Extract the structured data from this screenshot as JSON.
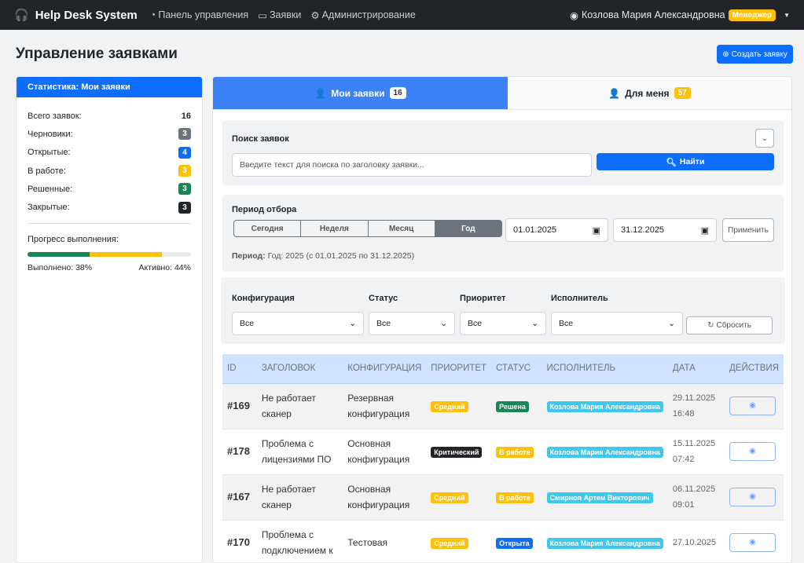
{
  "nav": {
    "brand": "Help Desk System",
    "links": [
      "Панель управления",
      "Заявки",
      "Администрирование"
    ],
    "user": "Козлова Мария Александровна",
    "role": "Менеджер"
  },
  "page": {
    "title": "Управление заявками",
    "create": "Создать заявку"
  },
  "stats": {
    "title": "Статистика: Мои заявки",
    "total_label": "Всего заявок:",
    "total": "16",
    "items": [
      {
        "label": "Черновики:",
        "value": "3",
        "color": "#6c757d"
      },
      {
        "label": "Открытые:",
        "value": "4",
        "color": "#0d6efd"
      },
      {
        "label": "В работе:",
        "value": "3",
        "color": "#ffc107"
      },
      {
        "label": "Решенные:",
        "value": "3",
        "color": "#198754"
      },
      {
        "label": "Закрытые:",
        "value": "3",
        "color": "#212529"
      }
    ],
    "progress_label": "Прогресс выполнения:",
    "done_pct": 38,
    "active_pct": 44,
    "done_text": "Выполнено: 38%",
    "active_text": "Активно: 44%"
  },
  "tabs": [
    {
      "label": "Мои заявки",
      "count": "16"
    },
    {
      "label": "Для меня",
      "count": "57"
    }
  ],
  "search": {
    "label": "Поиск заявок",
    "placeholder": "Введите текст для поиска по заголовку заявки...",
    "button": "Найти"
  },
  "period": {
    "label": "Период отбора",
    "options": [
      "Сегодня",
      "Неделя",
      "Месяц",
      "Год"
    ],
    "from": "01.01.2025",
    "to": "31.12.2025",
    "apply": "Применить",
    "summary_label": "Период:",
    "summary": "Год: 2025 (с 01.01.2025 по 31.12.2025)"
  },
  "filters": {
    "fields": [
      {
        "label": "Конфигурация",
        "value": "Все"
      },
      {
        "label": "Статус",
        "value": "Все"
      },
      {
        "label": "Приоритет",
        "value": "Все"
      },
      {
        "label": "Исполнитель",
        "value": "Все"
      }
    ],
    "reset": "Сбросить"
  },
  "table": {
    "headers": [
      "ID",
      "ЗАГОЛОВОК",
      "КОНФИГУРАЦИЯ",
      "ПРИОРИТЕТ",
      "СТАТУС",
      "ИСПОЛНИТЕЛЬ",
      "ДАТА",
      "ДЕЙСТВИЯ"
    ],
    "rows": [
      {
        "id": "#169",
        "title": "Не работает сканер",
        "config": "Резервная конфигурация",
        "priority": "Средний",
        "pcolor": "#ffc107",
        "status": "Решена",
        "scolor": "#198754",
        "assignee": "Козлова Мария Александровна",
        "date": "29.11.2025",
        "time": "16:48"
      },
      {
        "id": "#178",
        "title": "Проблема с лицензиями ПО",
        "config": "Основная конфигурация",
        "priority": "Критический",
        "pcolor": "#212529",
        "status": "В работе",
        "scolor": "#ffc107",
        "assignee": "Козлова Мария Александровна",
        "date": "15.11.2025",
        "time": "07:42"
      },
      {
        "id": "#167",
        "title": "Не работает сканер",
        "config": "Основная конфигурация",
        "priority": "Средний",
        "pcolor": "#ffc107",
        "status": "В работе",
        "scolor": "#ffc107",
        "assignee": "Смирнов Артем Викторович",
        "date": "06.11.2025",
        "time": "09:01"
      },
      {
        "id": "#170",
        "title": "Проблема с подключением к",
        "config": "Тестовая",
        "priority": "Средний",
        "pcolor": "#ffc107",
        "status": "Открыта",
        "scolor": "#0d6efd",
        "assignee": "Козлова Мария Александровна",
        "date": "27.10.2025",
        "time": ""
      }
    ]
  }
}
